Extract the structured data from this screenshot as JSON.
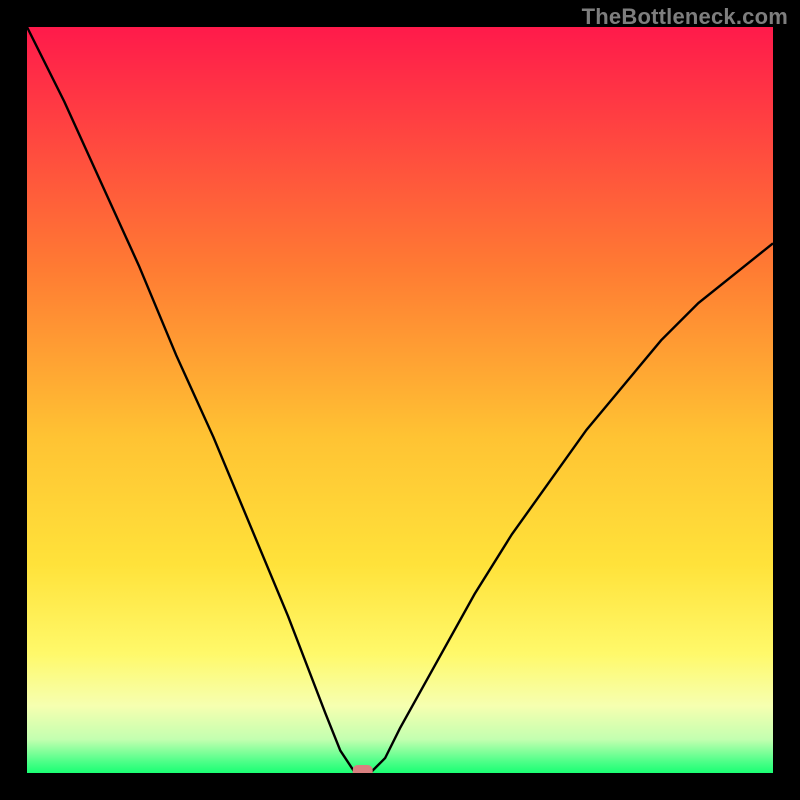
{
  "watermark": "TheBottleneck.com",
  "chart_data": {
    "type": "line",
    "title": "",
    "xlabel": "",
    "ylabel": "",
    "xlim": [
      0,
      100
    ],
    "ylim": [
      0,
      100
    ],
    "series": [
      {
        "name": "bottleneck-curve",
        "x": [
          0,
          5,
          10,
          15,
          20,
          25,
          30,
          35,
          40,
          42,
          44,
          45,
          46,
          48,
          50,
          55,
          60,
          65,
          70,
          75,
          80,
          85,
          90,
          95,
          100
        ],
        "values": [
          100,
          90,
          79,
          68,
          56,
          45,
          33,
          21,
          8,
          3,
          0,
          0,
          0,
          2,
          6,
          15,
          24,
          32,
          39,
          46,
          52,
          58,
          63,
          67,
          71
        ]
      }
    ],
    "marker": {
      "x": 45,
      "y": 0,
      "color": "#d98080",
      "shape": "rounded-rect"
    },
    "background_gradient": {
      "stops": [
        {
          "pos": 0.0,
          "color": "#ff1a4b"
        },
        {
          "pos": 0.32,
          "color": "#ff7a33"
        },
        {
          "pos": 0.55,
          "color": "#ffc333"
        },
        {
          "pos": 0.72,
          "color": "#ffe23a"
        },
        {
          "pos": 0.84,
          "color": "#fff96a"
        },
        {
          "pos": 0.91,
          "color": "#f6ffb0"
        },
        {
          "pos": 0.955,
          "color": "#c3ffb0"
        },
        {
          "pos": 0.985,
          "color": "#4dff88"
        },
        {
          "pos": 1.0,
          "color": "#1aff73"
        }
      ]
    }
  }
}
